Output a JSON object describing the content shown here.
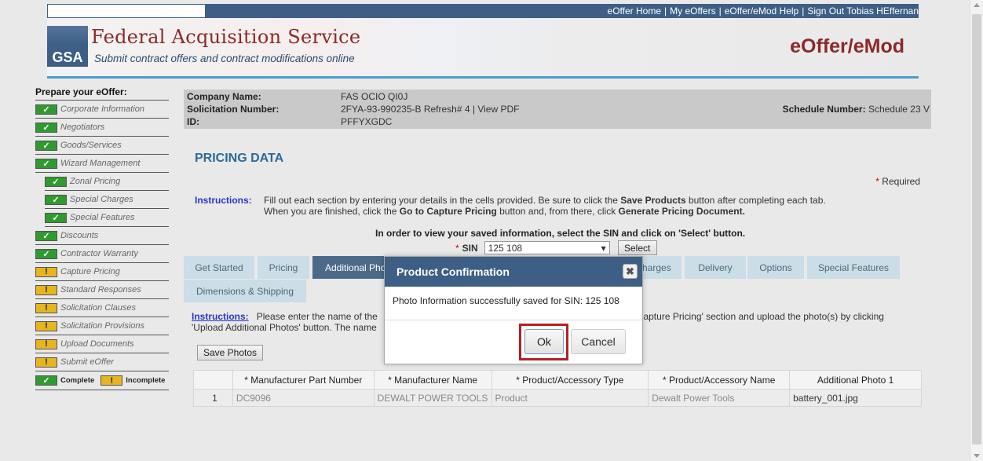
{
  "topnav": {
    "links": [
      "eOffer Home",
      "My eOffers",
      "eOffer/eMod Help",
      "Sign Out Tobias HEffernan"
    ]
  },
  "header": {
    "logo_text": "GSA",
    "title": "Federal Acquisition Service",
    "subtitle": "Submit contract offers and contract modifications online",
    "app_name": "eOffer/eMod"
  },
  "sidebar": {
    "title": "Prepare your eOffer:",
    "items": [
      {
        "label": "Corporate Information",
        "status": "complete",
        "sub": false
      },
      {
        "label": "Negotiators",
        "status": "complete",
        "sub": false
      },
      {
        "label": "Goods/Services",
        "status": "complete",
        "sub": false
      },
      {
        "label": "Wizard Management",
        "status": "complete",
        "sub": false
      },
      {
        "label": "Zonal Pricing",
        "status": "complete",
        "sub": true
      },
      {
        "label": "Special Charges",
        "status": "complete",
        "sub": true
      },
      {
        "label": "Special Features",
        "status": "complete",
        "sub": true
      },
      {
        "label": "Discounts",
        "status": "complete",
        "sub": false
      },
      {
        "label": "Contractor Warranty",
        "status": "complete",
        "sub": false
      },
      {
        "label": "Capture Pricing",
        "status": "incomplete",
        "sub": false
      },
      {
        "label": "Standard Responses",
        "status": "incomplete",
        "sub": false
      },
      {
        "label": "Solicitation Clauses",
        "status": "incomplete",
        "sub": false
      },
      {
        "label": "Solicitation Provisions",
        "status": "incomplete",
        "sub": false
      },
      {
        "label": "Upload Documents",
        "status": "incomplete",
        "sub": false
      },
      {
        "label": "Submit eOffer",
        "status": "incomplete",
        "sub": false
      }
    ],
    "legend_complete": "Complete",
    "legend_incomplete": "Incomplete"
  },
  "company": {
    "name_label": "Company Name:",
    "name": "FAS OCIO QI0J",
    "solicitation_label": "Solicitation Number:",
    "solicitation": "2FYA-93-990235-B Refresh# 4 |",
    "view_pdf": "View PDF",
    "id_label": "ID:",
    "id": "PFFYXGDC",
    "schedule_label": "Schedule Number:",
    "schedule": "Schedule 23 V"
  },
  "main": {
    "title": "PRICING DATA",
    "required_star": "*",
    "required": "Required",
    "instructions_label": "Instructions:",
    "instructions_line1_a": "Fill out each section by entering your details in the cells provided. Be sure to click the ",
    "instructions_line1_b": "Save Products",
    "instructions_line1_c": " button after completing each tab.",
    "instructions_line2_a": "When you are finished, click the ",
    "instructions_line2_b": "Go to Capture Pricing",
    "instructions_line2_c": " button and, from there, click ",
    "instructions_line2_d": "Generate Pricing Document.",
    "sin_note": "In order to view your saved information, select the SIN and click on 'Select' button.",
    "sin_star": "*",
    "sin_label": "SIN",
    "sin_value": "125 108",
    "select_button": "Select"
  },
  "tabs": [
    "Get Started",
    "Pricing",
    "Additional Photos",
    "Special Charges",
    "Delivery",
    "Options",
    "Special Features",
    "Dimensions & Shipping"
  ],
  "photos": {
    "instructions_label": "Instructions:",
    "instructions_a": "Please enter the name of the",
    "instructions_b": "Capture Pricing' section and upload the photo(s) by clicking",
    "instructions_c": "'Upload Additional Photos' button. The name",
    "save_button": "Save Photos"
  },
  "table": {
    "headers": [
      "",
      "* Manufacturer Part Number",
      "* Manufacturer Name",
      "* Product/Accessory Type",
      "* Product/Accessory Name",
      "Additional Photo 1"
    ],
    "rows": [
      [
        "1",
        "DC9096",
        "DEWALT POWER TOOLS",
        "Product",
        "Dewalt Power Tools",
        "battery_001.jpg"
      ]
    ]
  },
  "modal": {
    "title": "Product Confirmation",
    "message": "Photo Information successfully saved for SIN: 125 108",
    "ok": "Ok",
    "cancel": "Cancel"
  },
  "colors": {
    "nav_blue": "#3d5f85",
    "brand_red": "#8b2a2a",
    "complete_green": "#2f9a2f",
    "incomplete_yellow": "#e6b520",
    "highlight_red": "#b52025"
  }
}
